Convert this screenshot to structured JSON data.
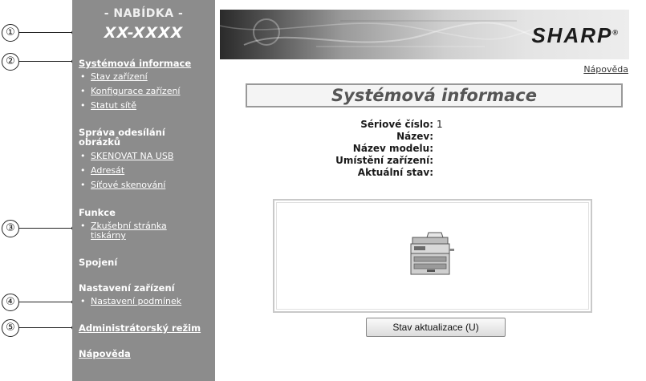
{
  "callouts": [
    "①",
    "②",
    "③",
    "④",
    "⑤"
  ],
  "sidebar": {
    "menu_header": "- NABÍDKA -",
    "model_name": "XX-XXXX",
    "system_info": {
      "label": "Systémová informace",
      "items": [
        "Stav zařízení",
        "Konfigurace zařízení",
        "Statut sítě"
      ]
    },
    "image_send": {
      "label_line1": "Správa odesílání",
      "label_line2": "obrázků",
      "items": [
        "SKENOVAT NA USB",
        "Adresát",
        "Síťové skenování"
      ]
    },
    "functions": {
      "label": "Funkce",
      "test_page_line1": "Zkušební stránka",
      "test_page_line2": "tiskárny"
    },
    "connections": "Spojení",
    "device_settings": {
      "label": "Nastavení zařízení",
      "items": [
        "Nastavení podmínek"
      ]
    },
    "admin_mode": "Administrátorský režim",
    "help": "Nápověda"
  },
  "header": {
    "brand": "SHARP",
    "brand_mark": "®",
    "help_link": "Nápověda"
  },
  "main": {
    "title": "Systémová informace",
    "fields": [
      {
        "label": "Sériové číslo:",
        "value": "1"
      },
      {
        "label": "Název:",
        "value": ""
      },
      {
        "label": "Název modelu:",
        "value": ""
      },
      {
        "label": "Umístění zařízení:",
        "value": ""
      },
      {
        "label": "Aktuální stav:",
        "value": ""
      }
    ],
    "device_icon": "copier-icon",
    "update_button": "Stav aktualizace (U)"
  }
}
